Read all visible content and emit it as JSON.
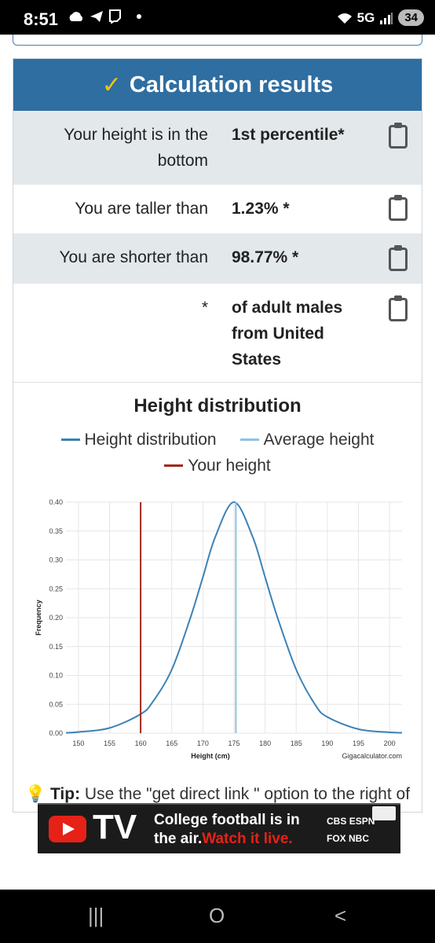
{
  "status_bar": {
    "time": "8:51",
    "network": "5G",
    "battery": "34"
  },
  "results": {
    "title": "Calculation results",
    "rows": [
      {
        "label": "Your height is in the bottom",
        "value": "1st percentile*"
      },
      {
        "label": "You are taller than",
        "value": "1.23% *"
      },
      {
        "label": "You are shorter than",
        "value": "98.77% *"
      },
      {
        "label": "*",
        "value": "of adult males from United States"
      }
    ]
  },
  "chart": {
    "title": "Height distribution",
    "legend": [
      {
        "name": "Height distribution",
        "color": "#3b82b5"
      },
      {
        "name": "Average height",
        "color": "#8ac3e6"
      },
      {
        "name": "Your height",
        "color": "#a0281c"
      }
    ],
    "credit": "Gigacalculator.com"
  },
  "chart_data": {
    "type": "line",
    "xlabel": "Height (cm)",
    "ylabel": "Frequency",
    "xlim": [
      148,
      202
    ],
    "ylim": [
      0,
      0.4
    ],
    "x_ticks": [
      "150",
      "155",
      "160",
      "165",
      "170",
      "175",
      "180",
      "185",
      "190",
      "195",
      "200"
    ],
    "y_ticks": [
      "0.00",
      "0.05",
      "0.10",
      "0.15",
      "0.20",
      "0.25",
      "0.30",
      "0.35",
      "0.40"
    ],
    "series": [
      {
        "name": "Height distribution",
        "x": [
          148,
          150,
          155,
          160,
          162,
          165,
          168,
          170,
          172,
          175,
          178,
          180,
          182,
          185,
          188,
          190,
          195,
          200,
          202
        ],
        "y": [
          0.0006,
          0.002,
          0.009,
          0.033,
          0.055,
          0.11,
          0.2,
          0.27,
          0.34,
          0.4,
          0.34,
          0.27,
          0.2,
          0.11,
          0.05,
          0.028,
          0.007,
          0.0015,
          0.0006
        ]
      },
      {
        "name": "Average height",
        "x": 175.3
      },
      {
        "name": "Your height",
        "x": 160
      }
    ],
    "grid": true
  },
  "tip": {
    "label": "Tip:",
    "text": "Use the \"get direct link \" option to the right of the graph to get a link to your calculation."
  },
  "ad": {
    "brand": "TV",
    "line1": "College football is in",
    "line2_white": "the air.",
    "line2_red": "Watch it live.",
    "net1": "CBS",
    "net2": "ESPN",
    "net3": "FOX",
    "net4": "NBC"
  },
  "nav": {
    "recents": "|||",
    "home": "O",
    "back": "<"
  }
}
